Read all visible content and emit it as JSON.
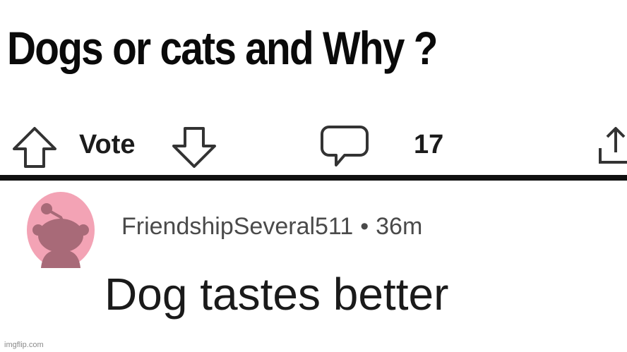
{
  "post": {
    "title": "Dogs or cats and Why ?",
    "vote_label": "Vote",
    "comment_count": "17",
    "icons": {
      "upvote": "arrow-up-outline-icon",
      "downvote": "arrow-down-outline-icon",
      "comments": "speech-bubble-icon",
      "share": "share-icon"
    }
  },
  "comment": {
    "username": "FriendshipSeveral511",
    "separator": "•",
    "time_ago": "36m",
    "body": "Dog tastes better",
    "avatar_icon": "reddit-snoo-avatar-icon",
    "avatar_color": "#f3a3b5"
  },
  "watermark": "imgflip.com"
}
